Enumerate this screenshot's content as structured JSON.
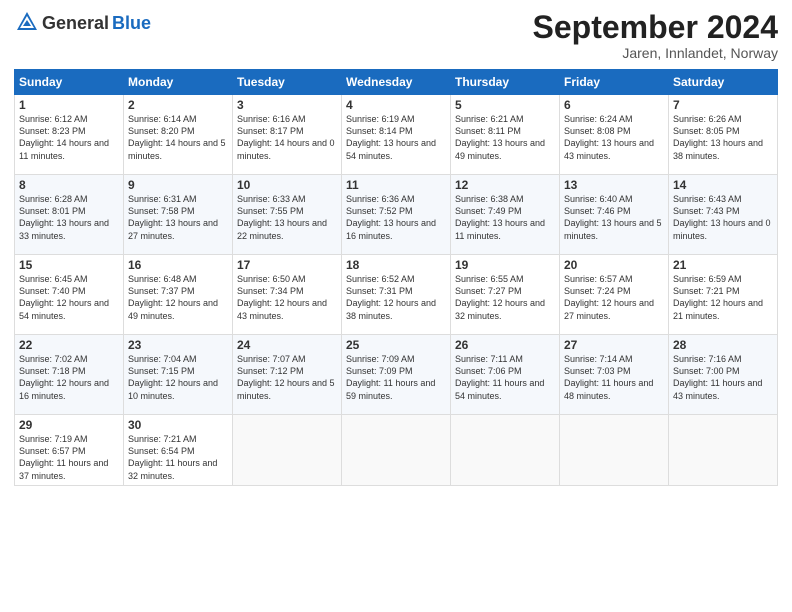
{
  "header": {
    "logo_line1": "General",
    "logo_line2": "Blue",
    "month": "September 2024",
    "location": "Jaren, Innlandet, Norway"
  },
  "weekdays": [
    "Sunday",
    "Monday",
    "Tuesday",
    "Wednesday",
    "Thursday",
    "Friday",
    "Saturday"
  ],
  "weeks": [
    [
      {
        "day": "1",
        "sunrise": "Sunrise: 6:12 AM",
        "sunset": "Sunset: 8:23 PM",
        "daylight": "Daylight: 14 hours and 11 minutes."
      },
      {
        "day": "2",
        "sunrise": "Sunrise: 6:14 AM",
        "sunset": "Sunset: 8:20 PM",
        "daylight": "Daylight: 14 hours and 5 minutes."
      },
      {
        "day": "3",
        "sunrise": "Sunrise: 6:16 AM",
        "sunset": "Sunset: 8:17 PM",
        "daylight": "Daylight: 14 hours and 0 minutes."
      },
      {
        "day": "4",
        "sunrise": "Sunrise: 6:19 AM",
        "sunset": "Sunset: 8:14 PM",
        "daylight": "Daylight: 13 hours and 54 minutes."
      },
      {
        "day": "5",
        "sunrise": "Sunrise: 6:21 AM",
        "sunset": "Sunset: 8:11 PM",
        "daylight": "Daylight: 13 hours and 49 minutes."
      },
      {
        "day": "6",
        "sunrise": "Sunrise: 6:24 AM",
        "sunset": "Sunset: 8:08 PM",
        "daylight": "Daylight: 13 hours and 43 minutes."
      },
      {
        "day": "7",
        "sunrise": "Sunrise: 6:26 AM",
        "sunset": "Sunset: 8:05 PM",
        "daylight": "Daylight: 13 hours and 38 minutes."
      }
    ],
    [
      {
        "day": "8",
        "sunrise": "Sunrise: 6:28 AM",
        "sunset": "Sunset: 8:01 PM",
        "daylight": "Daylight: 13 hours and 33 minutes."
      },
      {
        "day": "9",
        "sunrise": "Sunrise: 6:31 AM",
        "sunset": "Sunset: 7:58 PM",
        "daylight": "Daylight: 13 hours and 27 minutes."
      },
      {
        "day": "10",
        "sunrise": "Sunrise: 6:33 AM",
        "sunset": "Sunset: 7:55 PM",
        "daylight": "Daylight: 13 hours and 22 minutes."
      },
      {
        "day": "11",
        "sunrise": "Sunrise: 6:36 AM",
        "sunset": "Sunset: 7:52 PM",
        "daylight": "Daylight: 13 hours and 16 minutes."
      },
      {
        "day": "12",
        "sunrise": "Sunrise: 6:38 AM",
        "sunset": "Sunset: 7:49 PM",
        "daylight": "Daylight: 13 hours and 11 minutes."
      },
      {
        "day": "13",
        "sunrise": "Sunrise: 6:40 AM",
        "sunset": "Sunset: 7:46 PM",
        "daylight": "Daylight: 13 hours and 5 minutes."
      },
      {
        "day": "14",
        "sunrise": "Sunrise: 6:43 AM",
        "sunset": "Sunset: 7:43 PM",
        "daylight": "Daylight: 13 hours and 0 minutes."
      }
    ],
    [
      {
        "day": "15",
        "sunrise": "Sunrise: 6:45 AM",
        "sunset": "Sunset: 7:40 PM",
        "daylight": "Daylight: 12 hours and 54 minutes."
      },
      {
        "day": "16",
        "sunrise": "Sunrise: 6:48 AM",
        "sunset": "Sunset: 7:37 PM",
        "daylight": "Daylight: 12 hours and 49 minutes."
      },
      {
        "day": "17",
        "sunrise": "Sunrise: 6:50 AM",
        "sunset": "Sunset: 7:34 PM",
        "daylight": "Daylight: 12 hours and 43 minutes."
      },
      {
        "day": "18",
        "sunrise": "Sunrise: 6:52 AM",
        "sunset": "Sunset: 7:31 PM",
        "daylight": "Daylight: 12 hours and 38 minutes."
      },
      {
        "day": "19",
        "sunrise": "Sunrise: 6:55 AM",
        "sunset": "Sunset: 7:27 PM",
        "daylight": "Daylight: 12 hours and 32 minutes."
      },
      {
        "day": "20",
        "sunrise": "Sunrise: 6:57 AM",
        "sunset": "Sunset: 7:24 PM",
        "daylight": "Daylight: 12 hours and 27 minutes."
      },
      {
        "day": "21",
        "sunrise": "Sunrise: 6:59 AM",
        "sunset": "Sunset: 7:21 PM",
        "daylight": "Daylight: 12 hours and 21 minutes."
      }
    ],
    [
      {
        "day": "22",
        "sunrise": "Sunrise: 7:02 AM",
        "sunset": "Sunset: 7:18 PM",
        "daylight": "Daylight: 12 hours and 16 minutes."
      },
      {
        "day": "23",
        "sunrise": "Sunrise: 7:04 AM",
        "sunset": "Sunset: 7:15 PM",
        "daylight": "Daylight: 12 hours and 10 minutes."
      },
      {
        "day": "24",
        "sunrise": "Sunrise: 7:07 AM",
        "sunset": "Sunset: 7:12 PM",
        "daylight": "Daylight: 12 hours and 5 minutes."
      },
      {
        "day": "25",
        "sunrise": "Sunrise: 7:09 AM",
        "sunset": "Sunset: 7:09 PM",
        "daylight": "Daylight: 11 hours and 59 minutes."
      },
      {
        "day": "26",
        "sunrise": "Sunrise: 7:11 AM",
        "sunset": "Sunset: 7:06 PM",
        "daylight": "Daylight: 11 hours and 54 minutes."
      },
      {
        "day": "27",
        "sunrise": "Sunrise: 7:14 AM",
        "sunset": "Sunset: 7:03 PM",
        "daylight": "Daylight: 11 hours and 48 minutes."
      },
      {
        "day": "28",
        "sunrise": "Sunrise: 7:16 AM",
        "sunset": "Sunset: 7:00 PM",
        "daylight": "Daylight: 11 hours and 43 minutes."
      }
    ],
    [
      {
        "day": "29",
        "sunrise": "Sunrise: 7:19 AM",
        "sunset": "Sunset: 6:57 PM",
        "daylight": "Daylight: 11 hours and 37 minutes."
      },
      {
        "day": "30",
        "sunrise": "Sunrise: 7:21 AM",
        "sunset": "Sunset: 6:54 PM",
        "daylight": "Daylight: 11 hours and 32 minutes."
      },
      null,
      null,
      null,
      null,
      null
    ]
  ]
}
